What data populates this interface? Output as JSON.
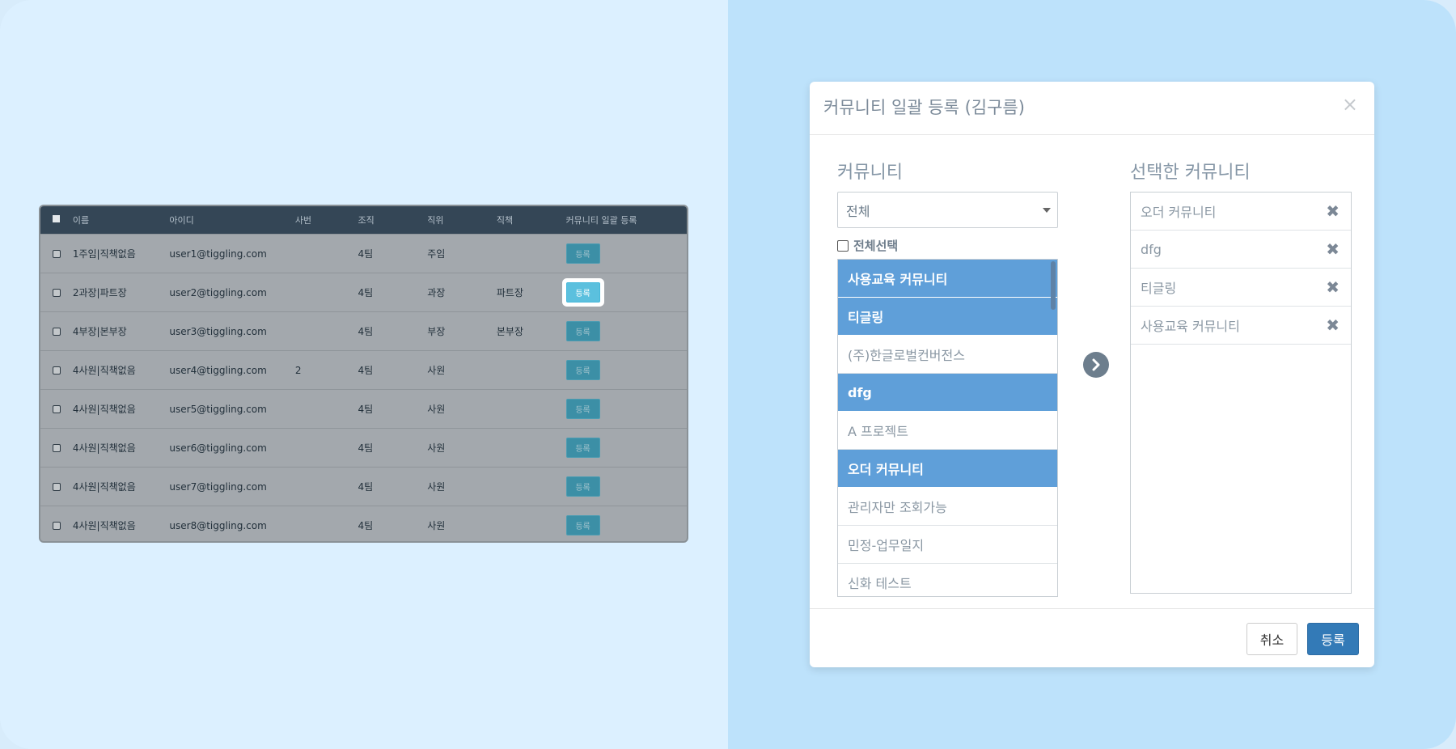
{
  "colors": {
    "table_header": "#344656",
    "table_body": "#a3a8ad",
    "register_button": "#3c8fa6",
    "register_button_active": "#5bc0de",
    "list_selected": "#5f9fd9",
    "primary_button": "#337ab7"
  },
  "table": {
    "headers": {
      "name": "이름",
      "id": "아이디",
      "emp_no": "사번",
      "org": "조직",
      "position": "직위",
      "role": "직책",
      "register": "커뮤니티 일괄 등록"
    },
    "rows": [
      {
        "name": "1주임|직책없음",
        "id": "user1@tiggling.com",
        "emp_no": "",
        "org": "4팀",
        "position": "주임",
        "role": "",
        "button": "등록",
        "active": false
      },
      {
        "name": "2과장|파트장",
        "id": "user2@tiggling.com",
        "emp_no": "",
        "org": "4팀",
        "position": "과장",
        "role": "파트장",
        "button": "등록",
        "active": true
      },
      {
        "name": "4부장|본부장",
        "id": "user3@tiggling.com",
        "emp_no": "",
        "org": "4팀",
        "position": "부장",
        "role": "본부장",
        "button": "등록",
        "active": false
      },
      {
        "name": "4사원|직책없음",
        "id": "user4@tiggling.com",
        "emp_no": "2",
        "org": "4팀",
        "position": "사원",
        "role": "",
        "button": "등록",
        "active": false
      },
      {
        "name": "4사원|직책없음",
        "id": "user5@tiggling.com",
        "emp_no": "",
        "org": "4팀",
        "position": "사원",
        "role": "",
        "button": "등록",
        "active": false
      },
      {
        "name": "4사원|직책없음",
        "id": "user6@tiggling.com",
        "emp_no": "",
        "org": "4팀",
        "position": "사원",
        "role": "",
        "button": "등록",
        "active": false
      },
      {
        "name": "4사원|직책없음",
        "id": "user7@tiggling.com",
        "emp_no": "",
        "org": "4팀",
        "position": "사원",
        "role": "",
        "button": "등록",
        "active": false
      },
      {
        "name": "4사원|직책없음",
        "id": "user8@tiggling.com",
        "emp_no": "",
        "org": "4팀",
        "position": "사원",
        "role": "",
        "button": "등록",
        "active": false
      }
    ]
  },
  "modal": {
    "title": "커뮤니티 일괄 등록 (김구름)",
    "close_icon": "×",
    "community_title": "커뮤니티",
    "selected_title": "선택한 커뮤니티",
    "filter_select": "전체",
    "select_all_label": "전체선택",
    "communities": [
      {
        "label": "사용교육 커뮤니티",
        "selected": true
      },
      {
        "label": "티글링",
        "selected": true
      },
      {
        "label": "(주)한글로벌컨버전스",
        "selected": false
      },
      {
        "label": "dfg",
        "selected": true
      },
      {
        "label": "A 프로젝트",
        "selected": false
      },
      {
        "label": "오더 커뮤니티",
        "selected": true
      },
      {
        "label": "관리자만 조회가능",
        "selected": false
      },
      {
        "label": "민정-업무일지",
        "selected": false
      },
      {
        "label": "신화 테스트",
        "selected": false
      }
    ],
    "selected_communities": [
      "오더 커뮤니티",
      "dfg",
      "티글링",
      "사용교육 커뮤니티"
    ],
    "remove_icon": "✖",
    "cancel_label": "취소",
    "submit_label": "등록"
  }
}
